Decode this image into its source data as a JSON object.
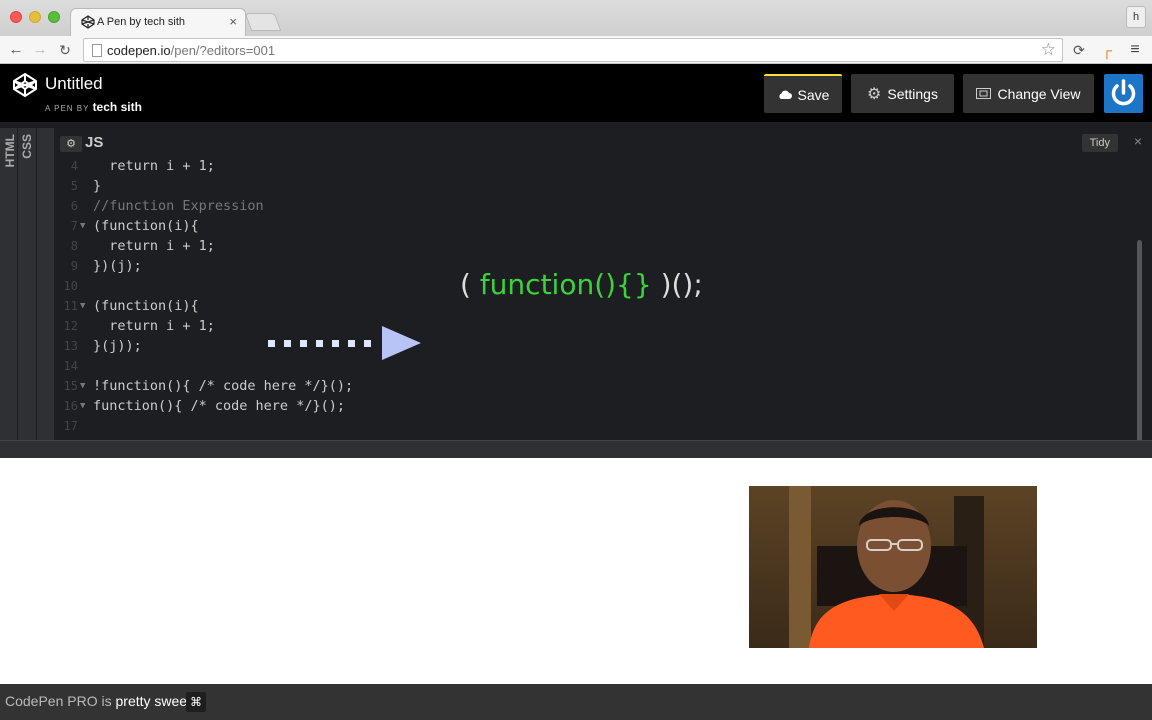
{
  "browser": {
    "tab_title": "A Pen by tech sith",
    "tab_close": "×",
    "profile_label": "h",
    "url_host": "codepen.io",
    "url_path": "/pen/?editors=001"
  },
  "header": {
    "title": "Untitled",
    "byline_prefix": "A PEN BY",
    "user": "tech sith",
    "save_label": "Save",
    "settings_label": "Settings",
    "change_view_label": "Change View"
  },
  "side_tabs": {
    "html": "HTML",
    "css": "CSS"
  },
  "editor": {
    "language": "JS",
    "tidy_label": "Tidy",
    "close_label": "×",
    "overlay_prefix": "( ",
    "overlay_highlight": "function(){}",
    "overlay_suffix": " )();"
  },
  "code_lines": [
    {
      "n": "4",
      "text": "  return i + 1;"
    },
    {
      "n": "5",
      "text": "}"
    },
    {
      "n": "6",
      "text": "//function Expression"
    },
    {
      "n": "7",
      "text": "(function(i){"
    },
    {
      "n": "8",
      "text": "  return i + 1;"
    },
    {
      "n": "9",
      "text": "})(j);"
    },
    {
      "n": "10",
      "text": ""
    },
    {
      "n": "11",
      "text": "(function(i){"
    },
    {
      "n": "12",
      "text": "  return i + 1;"
    },
    {
      "n": "13",
      "text": "}(j));"
    },
    {
      "n": "14",
      "text": ""
    },
    {
      "n": "15",
      "text": "!function(){ /* code here */}();"
    },
    {
      "n": "16",
      "text": "function(){ /* code here */}();"
    },
    {
      "n": "17",
      "text": ""
    }
  ],
  "footer": {
    "text_prefix": "CodePen PRO is",
    "text_bold": "pretty sweet.",
    "cmd_symbol": "⌘"
  }
}
